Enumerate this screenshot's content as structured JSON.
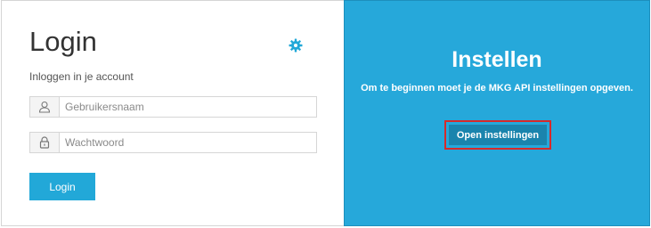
{
  "login": {
    "title": "Login",
    "subtitle": "Inloggen in je account",
    "username_placeholder": "Gebruikersnaam",
    "password_placeholder": "Wachtwoord",
    "login_button": "Login",
    "settings_icon": "gear-icon",
    "username_icon": "user-icon",
    "password_icon": "lock-icon"
  },
  "setup": {
    "title": "Instellen",
    "description": "Om te beginnen moet je de MKG API instellingen opgeven.",
    "open_settings_button": "Open instellingen"
  },
  "colors": {
    "accent": "#22a8d8",
    "setup_panel": "#26a8da",
    "setup_button": "#1a84ad",
    "highlight": "#d62a2a"
  }
}
